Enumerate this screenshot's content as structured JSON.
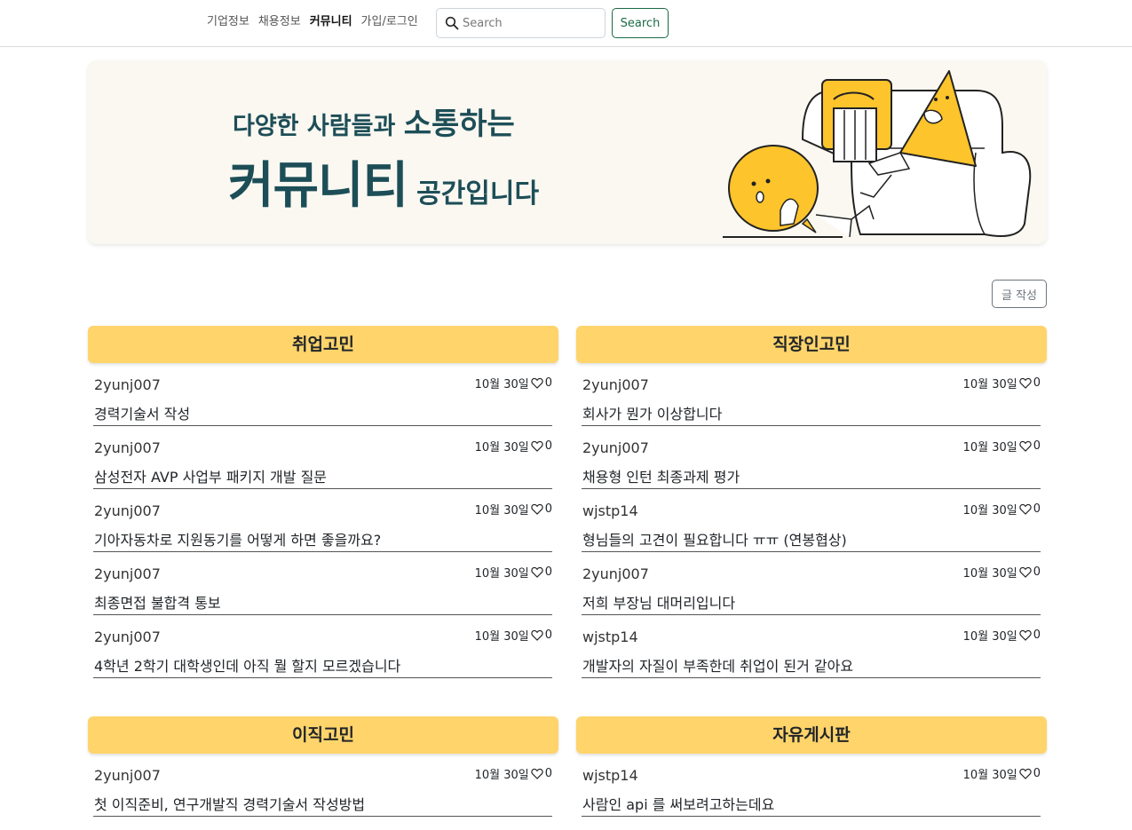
{
  "nav": {
    "links": [
      "기업정보",
      "채용정보",
      "커뮤니티",
      "가입/로그인"
    ],
    "active_index": 2,
    "search_placeholder": "Search",
    "search_button": "Search"
  },
  "banner": {
    "line1_small": "다양한 사람들과 ",
    "line1_large": "소통하는",
    "line2_large": "커뮤니티",
    "line2_small": "공간입니다"
  },
  "write_button": "글 작성",
  "colors": {
    "board_header": "#fed46b",
    "banner_text": "#1d4e57",
    "accent_green": "#1a6b44",
    "illustration_yellow": "#fdc42c"
  },
  "boards": [
    {
      "title": "취업고민",
      "posts": [
        {
          "author": "2yunj007",
          "date": "10월 30일",
          "likes": "0",
          "title": "경력기술서 작성"
        },
        {
          "author": "2yunj007",
          "date": "10월 30일",
          "likes": "0",
          "title": "삼성전자 AVP 사업부 패키지 개발 질문"
        },
        {
          "author": "2yunj007",
          "date": "10월 30일",
          "likes": "0",
          "title": "기아자동차로 지원동기를 어떻게 하면 좋을까요?"
        },
        {
          "author": "2yunj007",
          "date": "10월 30일",
          "likes": "0",
          "title": "최종면접 불합격 통보"
        },
        {
          "author": "2yunj007",
          "date": "10월 30일",
          "likes": "0",
          "title": "4학년 2학기 대학생인데 아직 뭘 할지 모르겠습니다"
        }
      ]
    },
    {
      "title": "직장인고민",
      "posts": [
        {
          "author": "2yunj007",
          "date": "10월 30일",
          "likes": "0",
          "title": "회사가 뭔가 이상합니다"
        },
        {
          "author": "2yunj007",
          "date": "10월 30일",
          "likes": "0",
          "title": "채용형 인턴 최종과제 평가"
        },
        {
          "author": "wjstp14",
          "date": "10월 30일",
          "likes": "0",
          "title": "형님들의 고견이 필요합니다 ㅠㅠ (연봉협상)"
        },
        {
          "author": "2yunj007",
          "date": "10월 30일",
          "likes": "0",
          "title": "저희 부장님 대머리입니다"
        },
        {
          "author": "wjstp14",
          "date": "10월 30일",
          "likes": "0",
          "title": "개발자의 자질이 부족한데 취업이 된거 같아요"
        }
      ]
    },
    {
      "title": "이직고민",
      "posts": [
        {
          "author": "2yunj007",
          "date": "10월 30일",
          "likes": "0",
          "title": "첫 이직준비, 연구개발직 경력기술서 작성방법"
        }
      ]
    },
    {
      "title": "자유게시판",
      "posts": [
        {
          "author": "wjstp14",
          "date": "10월 30일",
          "likes": "0",
          "title": "사람인 api 를 써보려고하는데요"
        }
      ]
    }
  ]
}
